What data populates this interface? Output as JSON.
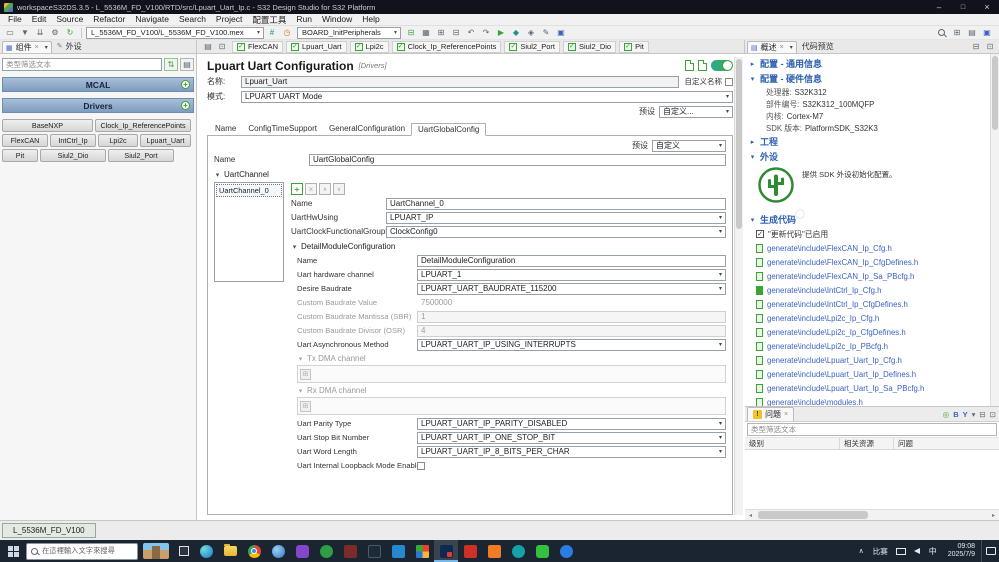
{
  "colors": {
    "accent_green": "#3aa435",
    "link_blue": "#3b62c4",
    "section_blue": "#2e62ae",
    "group_header_blue": "#7e9cc0",
    "taskbar_bg": "#1b2532"
  },
  "titlebar": {
    "title": "workspaceS32DS.3.5 - L_5536M_FD_V100/RTD/src/Lpuart_Uart_Ip.c - S32 Design Studio for S32 Platform"
  },
  "menubar": {
    "items": [
      "File",
      "Edit",
      "Source",
      "Refactor",
      "Navigate",
      "Search",
      "Project",
      "配置工具",
      "Run",
      "Window",
      "Help"
    ]
  },
  "toolbar": {
    "mex_combo": "L_5536M_FD_V100/L_5536M_FD_V100.mex",
    "group_combo": "BOARD_InitPeripherals",
    "icons_left": [
      {
        "name": "new-icon",
        "glyph": "▭"
      },
      {
        "name": "save-icon",
        "glyph": "▼"
      },
      {
        "name": "save-all-icon",
        "glyph": "⇊"
      },
      {
        "name": "settings-icon",
        "glyph": "⚙"
      },
      {
        "name": "update-code-icon",
        "glyph": "↻",
        "cls": "green"
      }
    ],
    "icons_mid": [
      {
        "name": "pins-icon",
        "glyph": "#",
        "cls": "teal"
      },
      {
        "name": "clocks-icon",
        "glyph": "◷",
        "cls": "orange"
      }
    ],
    "icons_right": [
      {
        "name": "peripherals-icon",
        "glyph": "⊟",
        "cls": "green"
      },
      {
        "name": "overview-icon",
        "glyph": "▦"
      },
      {
        "name": "expand-all-icon",
        "glyph": "⊞"
      },
      {
        "name": "collapse-all-icon",
        "glyph": "⊟"
      },
      {
        "name": "undo-icon",
        "glyph": "↶"
      },
      {
        "name": "redo-icon",
        "glyph": "↷"
      },
      {
        "name": "run-icon",
        "glyph": "▶",
        "cls": "green"
      },
      {
        "name": "debug-icon",
        "glyph": "◆",
        "cls": "teal"
      },
      {
        "name": "external-tools-icon",
        "glyph": "◈"
      },
      {
        "name": "annotation-icon",
        "glyph": "✎"
      },
      {
        "name": "skip-icon",
        "glyph": "▣",
        "cls": "blue"
      }
    ],
    "icons_persp": [
      {
        "name": "open-perspective-icon",
        "glyph": "⊞"
      },
      {
        "name": "cpp-perspective-icon",
        "glyph": "▤"
      },
      {
        "name": "config-perspective-icon",
        "glyph": "▣",
        "cls": "blue"
      }
    ]
  },
  "views": {
    "left_tabs": [
      "组件",
      "外设"
    ],
    "right_tabs": [
      "概述",
      "代码预览"
    ],
    "problems_tab": "问题"
  },
  "peripheral_bar": {
    "left_icons": [
      {
        "name": "editor-menu-icon",
        "glyph": "▤"
      },
      {
        "name": "pin-editor-icon",
        "glyph": "⊡"
      }
    ],
    "items": [
      "FlexCAN",
      "Lpuart_Uart",
      "Lpi2c",
      "Clock_Ip_ReferencePoints",
      "Siul2_Port",
      "Siul2_Dio",
      "Pit"
    ]
  },
  "components_panel": {
    "filter_placeholder": "类型筛选文本",
    "tools": [
      {
        "name": "sync-icon",
        "glyph": "⇅"
      },
      {
        "name": "view-menu-icon",
        "glyph": "▤"
      }
    ],
    "groups": [
      "MCAL",
      "Drivers"
    ],
    "items": [
      "BaseNXP",
      "Clock_Ip_ReferencePoints",
      "FlexCAN",
      "IntCtrl_Ip",
      "Lpi2c",
      "Lpuart_Uart",
      "Pit",
      "Siul2_Dio",
      "Siul2_Port"
    ]
  },
  "config": {
    "title": "Lpuart Uart Configuration",
    "category": "[Drivers]",
    "name_label": "名称:",
    "name_value": "Lpuart_Uart",
    "custom_name_label": "自定义名称",
    "mode_label": "模式:",
    "mode_value": "LPUART UART Mode",
    "preset_label": "预设",
    "preset_value": "自定义...",
    "tabs": [
      "Name",
      "ConfigTimeSupport",
      "GeneralConfiguration",
      "UartGlobalConfig"
    ],
    "active_tab": "UartGlobalConfig",
    "inner": {
      "preset_label": "预设",
      "preset_value": "自定义",
      "name_label": "Name",
      "name_value": "UartGlobalConfig",
      "channel_section": "UartChannel",
      "channel_items": [
        "UartChannel_0"
      ],
      "fields": {
        "name": {
          "label": "Name",
          "value": "UartChannel_0"
        },
        "hw_using": {
          "label": "UartHwUsing",
          "value": "LPUART_IP"
        },
        "clock_ref": {
          "label": "UartClockFunctionalGroupRef",
          "value": "ClockConfig0"
        }
      },
      "detail_section": "DetailModuleConfiguration",
      "detail": {
        "name": {
          "label": "Name",
          "value": "DetailModuleConfiguration"
        },
        "hw_channel": {
          "label": "Uart hardware channel",
          "value": "LPUART_1"
        },
        "baudrate": {
          "label": "Desire Baudrate",
          "value": "LPUART_UART_BAUDRATE_115200"
        },
        "custom_value": {
          "label": "Custom Baudrate Value",
          "value": "7500000"
        },
        "mantissa": {
          "label": "Custom Baudrate Mantissa (SBR)",
          "value": "1"
        },
        "divisor": {
          "label": "Custom Baudrate Divisor (OSR)",
          "value": "4"
        },
        "async_method": {
          "label": "Uart Asynchronous Method",
          "value": "LPUART_UART_IP_USING_INTERRUPTS"
        },
        "tx_dma": {
          "label": "Tx DMA channel"
        },
        "rx_dma": {
          "label": "Rx DMA channel"
        },
        "parity": {
          "label": "Uart Parity Type",
          "value": "LPUART_UART_IP_PARITY_DISABLED"
        },
        "stop_bit": {
          "label": "Uart Stop Bit Number",
          "value": "LPUART_UART_IP_ONE_STOP_BIT"
        },
        "word_length": {
          "label": "Uart Word Length",
          "value": "LPUART_UART_IP_8_BITS_PER_CHAR"
        },
        "loopback": {
          "label": "Uart Internal Loopback Mode Enable"
        }
      }
    }
  },
  "overview": {
    "sections": {
      "general": "配置 - 通用信息",
      "hardware": "配置 - 硬件信息",
      "project": "工程",
      "peripherals": "外设",
      "codegen": "生成代码"
    },
    "hardware_fields": [
      {
        "label": "处理器:",
        "value": "S32K312"
      },
      {
        "label": "部件编号:",
        "value": "S32K312_100MQFP"
      },
      {
        "label": "内核:",
        "value": "Cortex-M7"
      },
      {
        "label": "SDK 版本:",
        "value": "PlatformSDK_S32K3"
      }
    ],
    "peripherals_desc": "提供 SDK 外设初始化配置。",
    "codegen_note": "\"更新代码\"已启用",
    "files": [
      "generate\\include\\FlexCAN_Ip_Cfg.h",
      "generate\\include\\FlexCAN_Ip_CfgDefines.h",
      "generate\\include\\FlexCAN_Ip_Sa_PBcfg.h",
      "generate\\include\\IntCtrl_Ip_Cfg.h",
      "generate\\include\\IntCtrl_Ip_CfgDefines.h",
      "generate\\include\\Lpi2c_Ip_Cfg.h",
      "generate\\include\\Lpi2c_Ip_CfgDefines.h",
      "generate\\include\\Lpi2c_Ip_PBcfg.h",
      "generate\\include\\Lpuart_Uart_Ip_Cfg.h",
      "generate\\include\\Lpuart_Uart_Ip_Defines.h",
      "generate\\include\\Lpuart_Uart_Ip_Sa_PBcfg.h",
      "generate\\include\\modules.h"
    ]
  },
  "problems": {
    "filter_placeholder": "类型筛选文本",
    "columns": [
      "级别",
      "相关资源",
      "问题"
    ],
    "tools": [
      {
        "name": "clear-icon",
        "glyph": "◎",
        "cls": "g"
      },
      {
        "name": "filter-b-icon",
        "glyph": "B",
        "cls": "b"
      },
      {
        "name": "filter-y-icon",
        "glyph": "Y",
        "cls": "b"
      },
      {
        "name": "view-menu-icon",
        "glyph": "▾"
      },
      {
        "name": "minimize-view-icon",
        "glyph": "⊟"
      },
      {
        "name": "maximize-view-icon",
        "glyph": "⊡"
      }
    ]
  },
  "statusbar": {
    "label": "L_5536M_FD_V100"
  },
  "taskbar": {
    "search_placeholder": "在這裡輸入文字來搜尋",
    "apps": [
      {
        "app": "edge"
      },
      {
        "app": "explorer"
      },
      {
        "app": "chrome"
      },
      {
        "app": "ie"
      },
      {
        "app": "media"
      },
      {
        "app": "green-app"
      },
      {
        "app": "dev"
      },
      {
        "app": "terminal"
      },
      {
        "app": "vscode"
      },
      {
        "app": "office"
      },
      {
        "app": "s32ds",
        "state": "active"
      },
      {
        "app": "pdf"
      },
      {
        "app": "orange-app"
      },
      {
        "app": "teal-app"
      },
      {
        "app": "wechat"
      },
      {
        "app": "blue-app"
      }
    ],
    "tray_text": "比赛",
    "ime": "中",
    "time": "09:08",
    "date": "2025/7/9"
  }
}
